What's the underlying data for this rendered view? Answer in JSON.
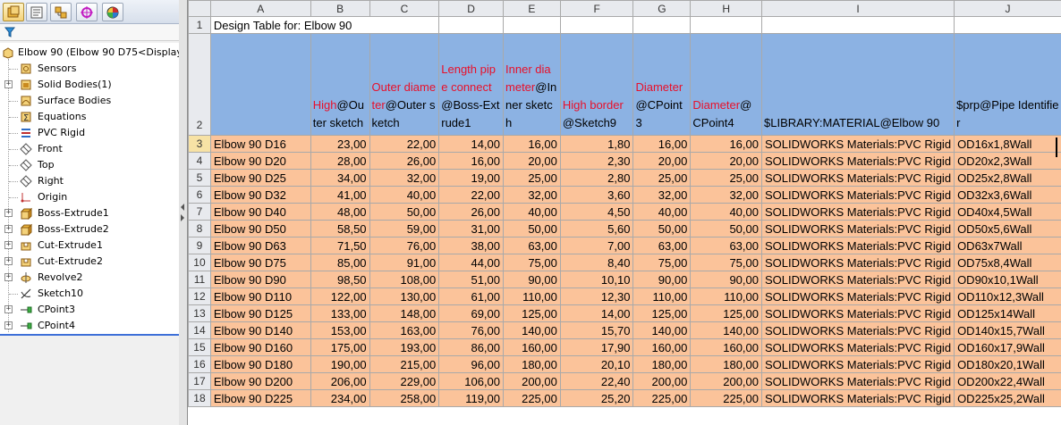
{
  "tree": {
    "root": "Elbow 90  (Elbow 90 D75<Display",
    "items": [
      {
        "label": "Sensors",
        "icon": "sensors-icon",
        "expand": false
      },
      {
        "label": "Solid Bodies(1)",
        "icon": "solid-bodies-icon",
        "expand": true
      },
      {
        "label": "Surface Bodies",
        "icon": "surface-bodies-icon",
        "expand": false
      },
      {
        "label": "Equations",
        "icon": "equations-icon",
        "expand": false
      },
      {
        "label": "PVC Rigid",
        "icon": "material-icon",
        "expand": false
      },
      {
        "label": "Front",
        "icon": "plane-icon",
        "expand": false
      },
      {
        "label": "Top",
        "icon": "plane-icon",
        "expand": false
      },
      {
        "label": "Right",
        "icon": "plane-icon",
        "expand": false
      },
      {
        "label": "Origin",
        "icon": "origin-icon",
        "expand": false
      },
      {
        "label": "Boss-Extrude1",
        "icon": "boss-extrude-icon",
        "expand": true
      },
      {
        "label": "Boss-Extrude2",
        "icon": "boss-extrude-icon",
        "expand": true
      },
      {
        "label": "Cut-Extrude1",
        "icon": "cut-extrude-icon",
        "expand": true
      },
      {
        "label": "Cut-Extrude2",
        "icon": "cut-extrude-icon",
        "expand": true
      },
      {
        "label": "Revolve2",
        "icon": "revolve-icon",
        "expand": true
      },
      {
        "label": "Sketch10",
        "icon": "sketch-icon",
        "expand": false
      },
      {
        "label": "CPoint3",
        "icon": "connection-point-icon",
        "expand": true
      },
      {
        "label": "CPoint4",
        "icon": "connection-point-icon",
        "expand": true
      }
    ]
  },
  "sheet": {
    "columns": [
      "A",
      "B",
      "C",
      "D",
      "E",
      "F",
      "G",
      "H",
      "I",
      "J"
    ],
    "title": "Design Table for: Elbow 90",
    "headers": [
      {
        "red": "",
        "black": ""
      },
      {
        "red": "High",
        "black": "@Outer sketch"
      },
      {
        "red": "Outer diameter",
        "black": "@Outer sketch"
      },
      {
        "red": "Length pipe connect",
        "black": "@Boss-Extrude1"
      },
      {
        "red": "Inner diameter",
        "black": "@Inner sketch"
      },
      {
        "red": "High border",
        "black": "@Sketch9"
      },
      {
        "red": "Diameter",
        "black": "@CPoint3"
      },
      {
        "red": "Diameter",
        "black": "@CPoint4"
      },
      {
        "red": "",
        "black": "$LIBRARY:MATERIAL@Elbow 90"
      },
      {
        "red": "",
        "black": "$prp@Pipe Identifier"
      }
    ],
    "rows": [
      [
        "Elbow 90 D16",
        "23,00",
        "22,00",
        "14,00",
        "16,00",
        "1,80",
        "16,00",
        "16,00",
        "SOLIDWORKS Materials:PVC Rigid",
        "OD16x1,8Wall"
      ],
      [
        "Elbow 90 D20",
        "28,00",
        "26,00",
        "16,00",
        "20,00",
        "2,30",
        "20,00",
        "20,00",
        "SOLIDWORKS Materials:PVC Rigid",
        "OD20x2,3Wall"
      ],
      [
        "Elbow 90 D25",
        "34,00",
        "32,00",
        "19,00",
        "25,00",
        "2,80",
        "25,00",
        "25,00",
        "SOLIDWORKS Materials:PVC Rigid",
        "OD25x2,8Wall"
      ],
      [
        "Elbow 90 D32",
        "41,00",
        "40,00",
        "22,00",
        "32,00",
        "3,60",
        "32,00",
        "32,00",
        "SOLIDWORKS Materials:PVC Rigid",
        "OD32x3,6Wall"
      ],
      [
        "Elbow 90 D40",
        "48,00",
        "50,00",
        "26,00",
        "40,00",
        "4,50",
        "40,00",
        "40,00",
        "SOLIDWORKS Materials:PVC Rigid",
        "OD40x4,5Wall"
      ],
      [
        "Elbow 90 D50",
        "58,50",
        "59,00",
        "31,00",
        "50,00",
        "5,60",
        "50,00",
        "50,00",
        "SOLIDWORKS Materials:PVC Rigid",
        "OD50x5,6Wall"
      ],
      [
        "Elbow 90 D63",
        "71,50",
        "76,00",
        "38,00",
        "63,00",
        "7,00",
        "63,00",
        "63,00",
        "SOLIDWORKS Materials:PVC Rigid",
        "OD63x7Wall"
      ],
      [
        "Elbow 90 D75",
        "85,00",
        "91,00",
        "44,00",
        "75,00",
        "8,40",
        "75,00",
        "75,00",
        "SOLIDWORKS Materials:PVC Rigid",
        "OD75x8,4Wall"
      ],
      [
        "Elbow 90 D90",
        "98,50",
        "108,00",
        "51,00",
        "90,00",
        "10,10",
        "90,00",
        "90,00",
        "SOLIDWORKS Materials:PVC Rigid",
        "OD90x10,1Wall"
      ],
      [
        "Elbow 90 D110",
        "122,00",
        "130,00",
        "61,00",
        "110,00",
        "12,30",
        "110,00",
        "110,00",
        "SOLIDWORKS Materials:PVC Rigid",
        "OD110x12,3Wall"
      ],
      [
        "Elbow 90 D125",
        "133,00",
        "148,00",
        "69,00",
        "125,00",
        "14,00",
        "125,00",
        "125,00",
        "SOLIDWORKS Materials:PVC Rigid",
        "OD125x14Wall"
      ],
      [
        "Elbow 90 D140",
        "153,00",
        "163,00",
        "76,00",
        "140,00",
        "15,70",
        "140,00",
        "140,00",
        "SOLIDWORKS Materials:PVC Rigid",
        "OD140x15,7Wall"
      ],
      [
        "Elbow 90 D160",
        "175,00",
        "193,00",
        "86,00",
        "160,00",
        "17,90",
        "160,00",
        "160,00",
        "SOLIDWORKS Materials:PVC Rigid",
        "OD160x17,9Wall"
      ],
      [
        "Elbow 90 D180",
        "190,00",
        "215,00",
        "96,00",
        "180,00",
        "20,10",
        "180,00",
        "180,00",
        "SOLIDWORKS Materials:PVC Rigid",
        "OD180x20,1Wall"
      ],
      [
        "Elbow 90 D200",
        "206,00",
        "229,00",
        "106,00",
        "200,00",
        "22,40",
        "200,00",
        "200,00",
        "SOLIDWORKS Materials:PVC Rigid",
        "OD200x22,4Wall"
      ],
      [
        "Elbow 90 D225",
        "234,00",
        "258,00",
        "119,00",
        "225,00",
        "25,20",
        "225,00",
        "225,00",
        "SOLIDWORKS Materials:PVC Rigid",
        "OD225x25,2Wall"
      ]
    ]
  }
}
